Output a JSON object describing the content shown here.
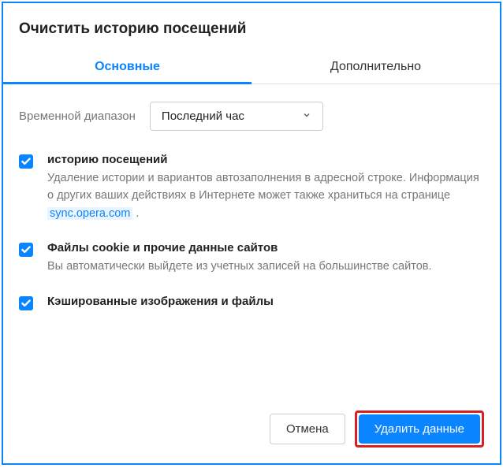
{
  "dialog": {
    "title": "Очистить историю посещений",
    "tabs": {
      "basic": "Основные",
      "advanced": "Дополнительно"
    },
    "time": {
      "label": "Временной диапазон",
      "selected": "Последний час"
    },
    "options": {
      "history": {
        "title": "историю посещений",
        "desc_before": "Удаление истории и вариантов автозаполнения в адресной строке. Информация о других ваших действиях в Интернете может также храниться на странице ",
        "link": "sync.opera.com",
        "desc_after": " ."
      },
      "cookies": {
        "title": "Файлы cookie и прочие данные сайтов",
        "desc": "Вы автоматически выйдете из учетных записей на большинстве сайтов."
      },
      "cache": {
        "title": "Кэшированные изображения и файлы"
      }
    },
    "buttons": {
      "cancel": "Отмена",
      "confirm": "Удалить данные"
    }
  }
}
